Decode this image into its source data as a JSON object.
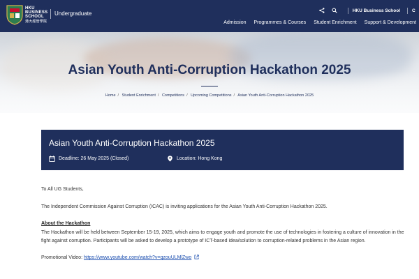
{
  "header": {
    "logo_text": [
      "HKU",
      "BUSINESS",
      "SCHOOL",
      "港大經管學院"
    ],
    "site_name": "Undergraduate",
    "utility_link": "HKU Business School",
    "utility_cut": "C",
    "nav": [
      "Admission",
      "Programmes & Courses",
      "Student Enrichment",
      "Support & Development"
    ],
    "icons": [
      "share-icon",
      "search-icon"
    ],
    "colors": {
      "navy": "#1f2f5c"
    }
  },
  "hero": {
    "title": "Asian Youth Anti-Corruption Hackathon 2025",
    "breadcrumb": [
      "Home",
      "Student Enrichment",
      "Competitions",
      "Upcoming Competitions",
      "Asian Youth Anti-Corruption Hackathon 2025"
    ]
  },
  "event": {
    "title": "Asian Youth Anti-Corruption Hackathon 2025",
    "deadline": "Deadline: 26 May 2025 (Closed)",
    "location": "Location: Hong Kong",
    "icons": [
      "calendar-icon",
      "location-pin-icon"
    ]
  },
  "content": {
    "greeting": "To All UG Students,",
    "intro": "The Independent Commission Against Corruption (ICAC) is inviting applications for the Asian Youth Anti-Corruption Hackathon 2025.",
    "about_heading": "About the Hackathon",
    "about_text": "The Hackathon will be held between September 15-19, 2025, which aims to engage youth and promote the use of technologies in fostering a culture of innovation in the fight against corruption. Participants will be asked to develop a prototype of ICT-based idea/solution to corruption-related problems in the Asian region.",
    "video_label": "Promotional Video:",
    "video_url": "https://www.youtube.com/watch?v=qzouULMlZwo"
  }
}
